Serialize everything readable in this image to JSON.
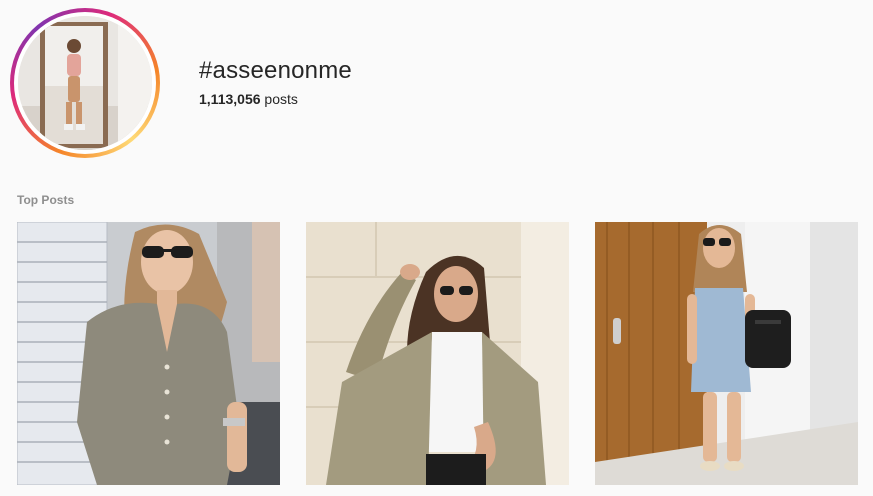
{
  "header": {
    "hashtag": "#asseenonme",
    "post_count_value": "1,113,056",
    "post_count_unit": "posts"
  },
  "sections": {
    "top_posts_label": "Top Posts"
  },
  "posts": [
    {
      "subject": "woman in olive button blouse and aviator sunglasses"
    },
    {
      "subject": "woman in olive trench jacket leaning on stone wall"
    },
    {
      "subject": "woman in denim romper with black backpack by wooden door"
    }
  ],
  "colors": {
    "text_primary": "#262626",
    "text_secondary": "#8e8e8e",
    "background": "#fafafa",
    "story_ring_start": "#f58529",
    "story_ring_end": "#dd2a7b"
  }
}
